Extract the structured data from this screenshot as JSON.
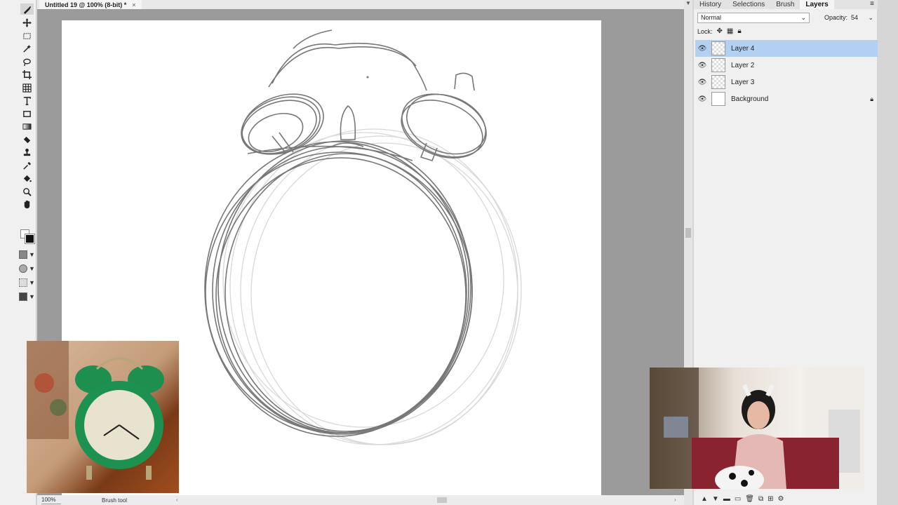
{
  "document": {
    "tab_title": "Untitled 19 @ 100% (8-bit) *",
    "tab_close": "×"
  },
  "toolbar": {
    "tools": [
      "brush-tool",
      "move-tool",
      "rect-select-tool",
      "magic-wand-tool",
      "lasso-tool",
      "crop-tool",
      "grid-tool",
      "text-tool",
      "shape-tool",
      "gradient-tool",
      "eraser-tool",
      "stamp-tool",
      "eyedropper-tool",
      "fill-tool",
      "zoom-tool",
      "hand-tool"
    ],
    "active_tool": "brush-tool"
  },
  "status_bar": {
    "zoom": "100%",
    "tool_name": "Brush tool"
  },
  "panel": {
    "tabs": [
      {
        "label": "History",
        "active": false
      },
      {
        "label": "Selections",
        "active": false
      },
      {
        "label": "Brush",
        "active": false
      },
      {
        "label": "Layers",
        "active": true
      }
    ],
    "blend_mode": "Normal",
    "opacity_label": "Opacity:",
    "opacity_value": "54",
    "lock_label": "Lock:",
    "layers": [
      {
        "name": "Layer 4",
        "selected": true,
        "locked": false,
        "thumb": "sketch"
      },
      {
        "name": "Layer 2",
        "selected": false,
        "locked": false,
        "thumb": "sketch"
      },
      {
        "name": "Layer 3",
        "selected": false,
        "locked": false,
        "thumb": "transparent"
      },
      {
        "name": "Background",
        "selected": false,
        "locked": true,
        "thumb": "white"
      }
    ]
  },
  "colors": {
    "selected_layer": "#b3d0f2",
    "sketch_stroke": "#777777",
    "canvas": "#ffffff",
    "workspace": "#9b9b9b"
  }
}
